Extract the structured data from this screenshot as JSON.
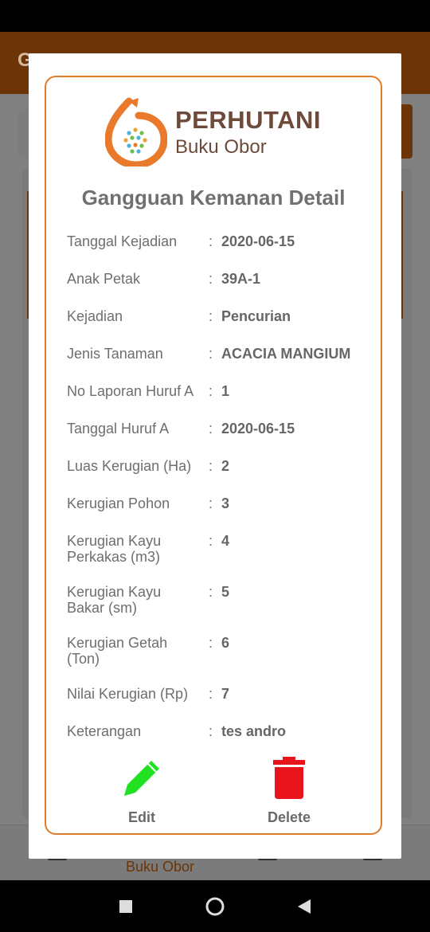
{
  "background": {
    "app_title": "G",
    "bottom_nav_label": "Buku Obor"
  },
  "dialog": {
    "brand_name": "PERHUTANI",
    "brand_subtitle": "Buku Obor",
    "title": "Gangguan Kemanan Detail",
    "fields": [
      {
        "label": "Tanggal Kejadian",
        "value": "2020-06-15"
      },
      {
        "label": "Anak Petak",
        "value": "39A-1"
      },
      {
        "label": "Kejadian",
        "value": "Pencurian"
      },
      {
        "label": "Jenis Tanaman",
        "value": "ACACIA MANGIUM"
      },
      {
        "label": "No Laporan Huruf A",
        "value": "1"
      },
      {
        "label": "Tanggal Huruf A",
        "value": "2020-06-15"
      },
      {
        "label": "Luas Kerugian (Ha)",
        "value": "2"
      },
      {
        "label": "Kerugian Pohon",
        "value": "3"
      },
      {
        "label": "Kerugian Kayu Perkakas (m3)",
        "value": "4"
      },
      {
        "label": "Kerugian Kayu Bakar (sm)",
        "value": "5"
      },
      {
        "label": "Kerugian Getah (Ton)",
        "value": "6"
      },
      {
        "label": "Nilai Kerugian (Rp)",
        "value": "7"
      },
      {
        "label": "Keterangan",
        "value": "tes andro"
      }
    ],
    "colon": ":",
    "actions": {
      "edit_label": "Edit",
      "edit_icon": "pencil-icon",
      "edit_color": "#22e022",
      "delete_label": "Delete",
      "delete_icon": "trash-icon",
      "delete_color": "#e8141c"
    }
  },
  "colors": {
    "accent": "#e07d2c",
    "brand_text": "#6d4a3a"
  }
}
